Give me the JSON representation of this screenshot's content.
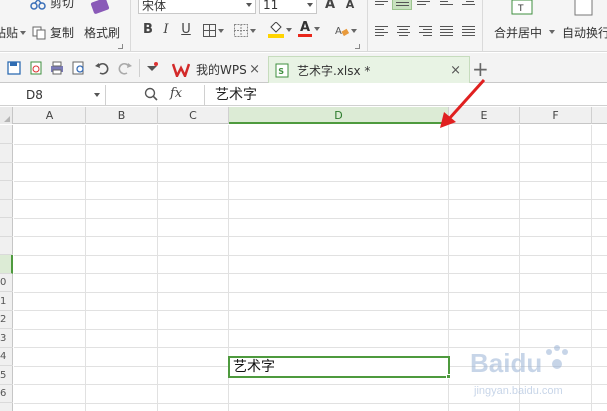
{
  "ribbon": {
    "clipboard": {
      "cut_label": "剪切",
      "paste_label": "粘贴",
      "copy_label": "复制",
      "format_painter_label": "格式刷"
    },
    "font": {
      "font_name": "宋体",
      "font_size": "11",
      "bold": "B",
      "italic": "I",
      "underline": "U",
      "grow": "A",
      "shrink": "A",
      "font_color_glyph": "A",
      "fill_color": "#ffd400",
      "font_color": "#e8271b"
    },
    "merge_label": "合并居中",
    "wrap_label": "自动换行"
  },
  "tabs": [
    {
      "label": "我的WPS",
      "close": "×"
    },
    {
      "label": "艺术字.xlsx *",
      "close": "×"
    }
  ],
  "add_tab": "+",
  "formula_bar": {
    "cell_ref": "D8",
    "fx": "fx",
    "content": "艺术字"
  },
  "sheet": {
    "columns": [
      "A",
      "B",
      "C",
      "D",
      "E",
      "F"
    ],
    "selected_column": "D",
    "row_labels": [
      "",
      "",
      "",
      "",
      "",
      "",
      "",
      "",
      "0",
      "1",
      "2",
      "3",
      "4",
      "5",
      "6"
    ],
    "selected_cell_text": "艺术字",
    "accent_color": "#4e9a3e"
  },
  "watermark": {
    "brand": "Baidu",
    "sub": "jingyan.baidu.com"
  }
}
